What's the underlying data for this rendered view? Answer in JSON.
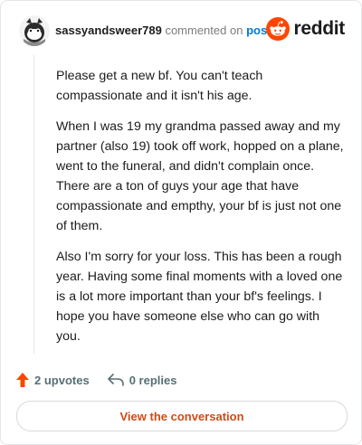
{
  "comment": {
    "username": "sassyandsweer789",
    "action": "commented on",
    "post_link": "post",
    "paragraphs": [
      "Please get a new bf. You can't teach compassionate and it isn't his age.",
      "When I was 19 my grandma passed away and my partner (also 19) took off work, hopped on a plane, went to the funeral, and didn't complain once. There are a ton of guys your age that have compassionate and empthy, your bf is just not one of them.",
      "Also I'm sorry for your loss. This has been a rough year. Having some final moments with a loved one is a lot more important than your bf's feelings. I hope you have someone else who can go with you."
    ]
  },
  "brand": {
    "wordmark": "reddit",
    "color": "#ff4500"
  },
  "actions": {
    "upvotes_label": "2 upvotes",
    "replies_label": "0 replies",
    "upvote_color": "#ff4500"
  },
  "footer": {
    "view_label": "View the conversation"
  },
  "icons": [
    "avatar",
    "reddit-logo-icon",
    "upvote-arrow-icon",
    "reply-icon"
  ]
}
